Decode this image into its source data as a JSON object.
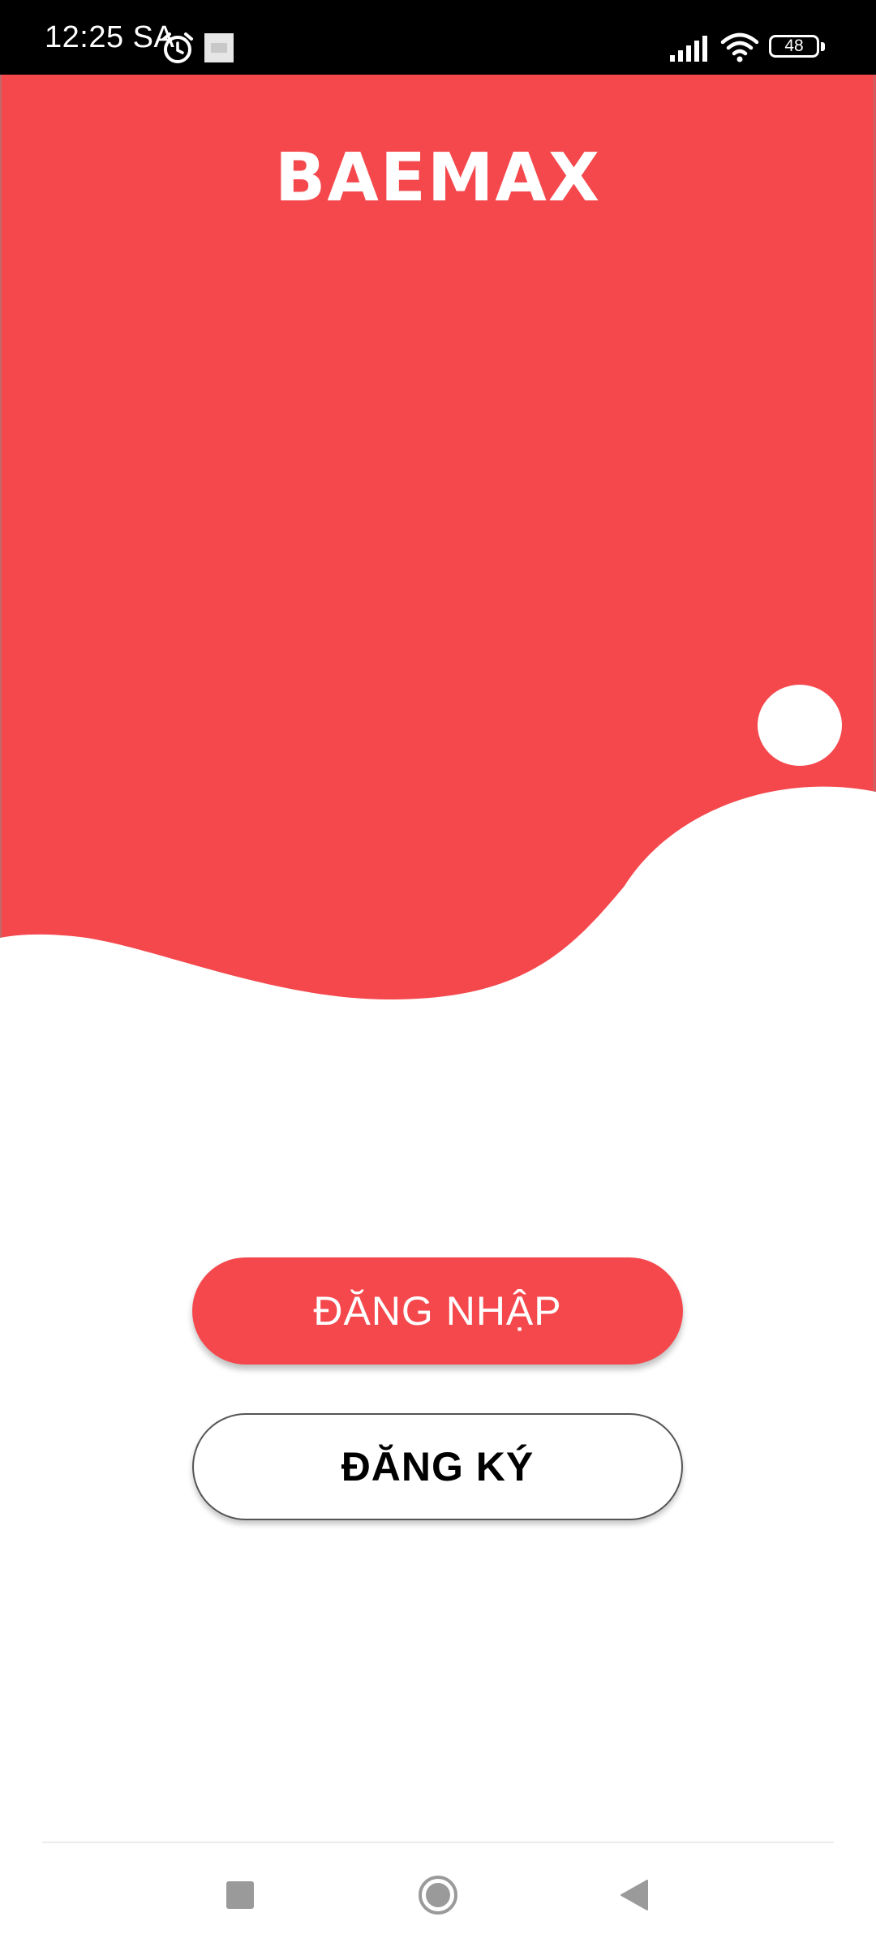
{
  "status_bar": {
    "time": "12:25 SA",
    "battery_level": "48",
    "icons": [
      "alarm-icon",
      "notification-image-icon",
      "signal-icon",
      "wifi-icon",
      "battery-icon"
    ]
  },
  "app": {
    "logo_text": "BAEMAX",
    "brand_color": "#f4484d"
  },
  "actions": {
    "login_label": "ĐĂNG NHẬP",
    "register_label": "ĐĂNG KÝ"
  },
  "nav_bar": {
    "buttons": [
      "recents-square-icon",
      "home-circle-icon",
      "back-triangle-icon"
    ]
  }
}
